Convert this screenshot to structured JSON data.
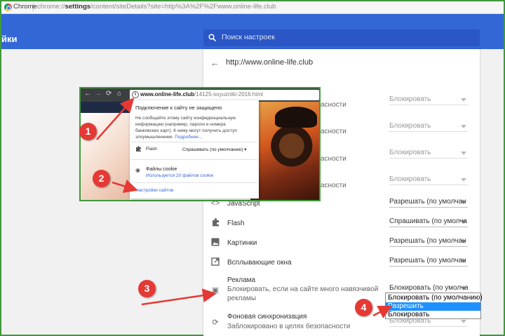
{
  "browser": {
    "name": "Chrome",
    "url_scheme": "chrome://",
    "url_host": "settings",
    "url_rest": "/content/siteDetails?site=http%3A%2F%2Fwww.online-life.club"
  },
  "header": {
    "title": "йки",
    "search_placeholder": "Поиск настроек"
  },
  "site": {
    "url": "http://www.online-life.club"
  },
  "rows_hidden": [
    {
      "sub": "асности",
      "value": "Блокировать"
    },
    {
      "sub": "асности",
      "value": "Блокировать"
    },
    {
      "sub": "асности",
      "value": "Блокировать"
    },
    {
      "sub": "асности",
      "value": "Блокировать"
    }
  ],
  "rows": [
    {
      "label": "JavaScript",
      "value": "Разрешать (по умолчан"
    },
    {
      "label": "Flash",
      "value": "Спрашивать (по умолча"
    },
    {
      "label": "Картинки",
      "value": "Разрешать (по умолчан"
    },
    {
      "label": "Всплывающие окна",
      "value": "Разрешать (по умолчан"
    }
  ],
  "ads": {
    "label": "Реклама",
    "sub1": "Блокировать, если на сайте много навязчивой",
    "sub2": "рекламы",
    "value": "Блокировать (по умолча"
  },
  "background_sync": {
    "label": "Фоновая синхронизация",
    "sub": "Заблокировано в целях безопасности",
    "value": "Блокировать"
  },
  "dropdown": {
    "options": [
      "Блокировать (по умолчанию)",
      "Разрешить",
      "Блокировать"
    ],
    "selected_index": 1
  },
  "popup": {
    "url_host": "www.online-life.club",
    "url_path": "/14125-soyuzniki-2016.html",
    "title": "Подключение к сайту не защищено",
    "desc1": "Не сообщайте этому сайту конфиденциальную",
    "desc2": "информацию (например, пароли и номера",
    "desc3": "банковских карт). К нему могут получить доступ",
    "desc4": "злоумышленники.",
    "more": "Подробнее...",
    "flash_label": "Flash",
    "flash_value": "Спрашивать (по умолчанию)",
    "cookies_label": "Файлы cookie",
    "cookies_sub": "Используется 20 файлов cookie",
    "site_settings": "Настройки сайтов"
  },
  "badges": [
    "1",
    "2",
    "3",
    "4"
  ],
  "colors": {
    "header": "#3367d6",
    "frame": "#3f9a3a",
    "badge": "#e53935",
    "selected": "#1e90ff"
  }
}
